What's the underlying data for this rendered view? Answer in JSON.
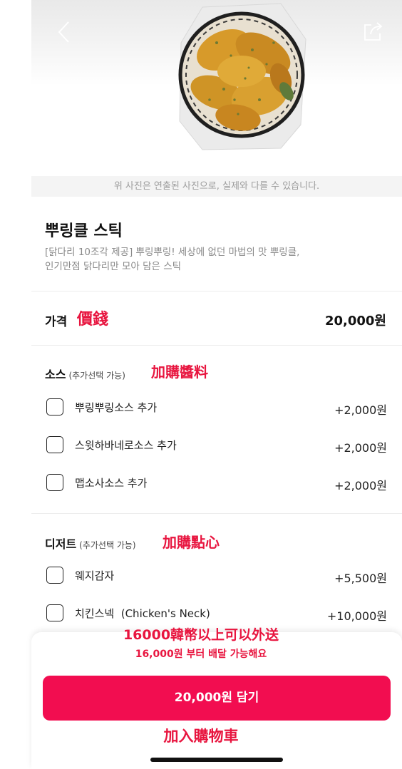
{
  "header": {
    "back_icon": "chevron-left-icon",
    "share_icon": "share-icon"
  },
  "photo_note": "위 사진은 연출된 사진으로, 실제와 다를 수 있습니다.",
  "product": {
    "title": "뿌링클 스틱",
    "description_line1": "[닭다리 10조각 제공] 뿌링뿌링! 세상에 없던 마법의 맛 뿌링클,",
    "description_line2": "인기만점 닭다리만 모아 담은 스틱"
  },
  "price": {
    "label": "가격",
    "value": "20,000원"
  },
  "sauce_section": {
    "title": "소스",
    "subtitle": "(추가선택 가능)",
    "options": [
      {
        "label": "뿌링뿌링소스 추가",
        "price": "+2,000원"
      },
      {
        "label": "스윗하바네로소스 추가",
        "price": "+2,000원"
      },
      {
        "label": "맵소사소스 추가",
        "price": "+2,000원"
      }
    ]
  },
  "dessert_section": {
    "title": "디저트",
    "subtitle": "(추가선택 가능)",
    "options": [
      {
        "label": "웨지감자",
        "price": "+5,500원"
      },
      {
        "label": "치킨스넥  (Chicken's Neck)",
        "price": "+10,000원"
      }
    ]
  },
  "annotations": {
    "price": "價錢",
    "sauce": "加購醬料",
    "dessert": "加購點心",
    "min_order": "16000韓幣以上可以外送",
    "cart": "加入購物車"
  },
  "bottom": {
    "min_order_text": "16,000원 부터 배달 가능해요",
    "cart_button_label": "20,000원 담기"
  },
  "colors": {
    "accent": "#f20d50",
    "annotation": "#e8153f"
  }
}
